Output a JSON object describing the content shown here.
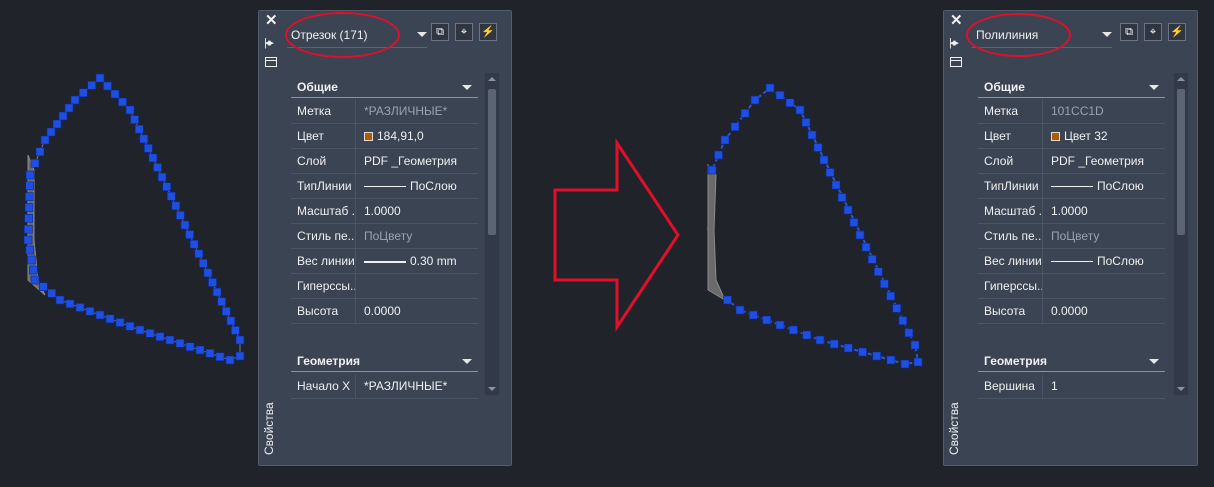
{
  "left_palette": {
    "selection": "Отрезок (171)",
    "sections": {
      "general": "Общие",
      "geometry": "Геометрия"
    },
    "rows": [
      {
        "key": "Метка",
        "value": "*РАЗЛИЧНЫЕ*"
      },
      {
        "key": "Цвет",
        "value": "184,91,0"
      },
      {
        "key": "Слой",
        "value": "PDF _Геометрия"
      },
      {
        "key": "ТипЛинии",
        "value": "ПоСлою"
      },
      {
        "key": "Масштаб ...",
        "value": "1.0000"
      },
      {
        "key": "Стиль пе...",
        "value": "ПоЦвету"
      },
      {
        "key": "Вес линии",
        "value": "0.30 mm"
      },
      {
        "key": "Гиперссы...",
        "value": ""
      },
      {
        "key": "Высота",
        "value": "0.0000"
      }
    ],
    "geom_rows": [
      {
        "key": "Начало X",
        "value": "*РАЗЛИЧНЫЕ*"
      }
    ],
    "side_title": "Свойства"
  },
  "right_palette": {
    "selection": "Полилиния",
    "sections": {
      "general": "Общие",
      "geometry": "Геометрия"
    },
    "rows": [
      {
        "key": "Метка",
        "value": "101CC1D"
      },
      {
        "key": "Цвет",
        "value": "Цвет 32"
      },
      {
        "key": "Слой",
        "value": "PDF _Геометрия"
      },
      {
        "key": "ТипЛинии",
        "value": "ПоСлою"
      },
      {
        "key": "Масштаб ...",
        "value": "1.0000"
      },
      {
        "key": "Стиль пе...",
        "value": "ПоЦвету"
      },
      {
        "key": "Вес линии",
        "value": "ПоСлою"
      },
      {
        "key": "Гиперссы...",
        "value": ""
      },
      {
        "key": "Высота",
        "value": "0.0000"
      }
    ],
    "geom_rows": [
      {
        "key": "Вершина",
        "value": "1"
      }
    ],
    "side_title": "Свойства"
  },
  "colors": {
    "background": "#202329",
    "grip_blue": "#1f4fe0",
    "highlight_red": "#e0102a",
    "color_swatch": "#b35a00"
  },
  "icons": [
    "close-icon",
    "pin-icon",
    "menu-icon",
    "select-objects-icon",
    "pick-add-icon",
    "quick-select-icon",
    "chevron-down-icon",
    "arrow-right-icon"
  ]
}
